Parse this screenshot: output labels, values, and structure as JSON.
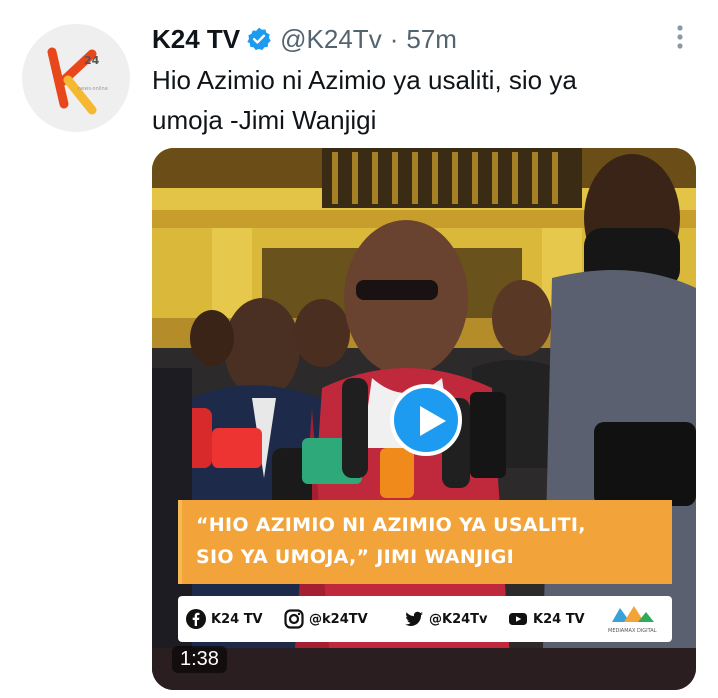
{
  "account": {
    "avatar_text": "K24",
    "name": "K24 TV",
    "handle": "@K24Tv",
    "separator": "·",
    "timestamp": "57m",
    "verified": true
  },
  "tweet": {
    "text_line1": "Hio Azimio ni Azimio ya usaliti, sio ya",
    "text_line2": "umoja -Jimi Wanjigi"
  },
  "video": {
    "caption_line1": "“HIO AZIMIO NI AZIMIO YA USALITI,",
    "caption_line2": "SIO YA UMOJA,” JIMI WANJIGI",
    "duration": "1:38",
    "socials": {
      "facebook": "K24 TV",
      "instagram": "@k24TV",
      "twitter": "@K24Tv",
      "youtube": "K24 TV",
      "brand": "MEDIAMAX DIGITAL"
    }
  },
  "colors": {
    "play_button": "#1d9bf0",
    "verified_badge": "#1d9bf0",
    "caption_bg": "#f2a33a",
    "avatar_accent": "#e8471c",
    "avatar_secondary": "#f5b830"
  }
}
